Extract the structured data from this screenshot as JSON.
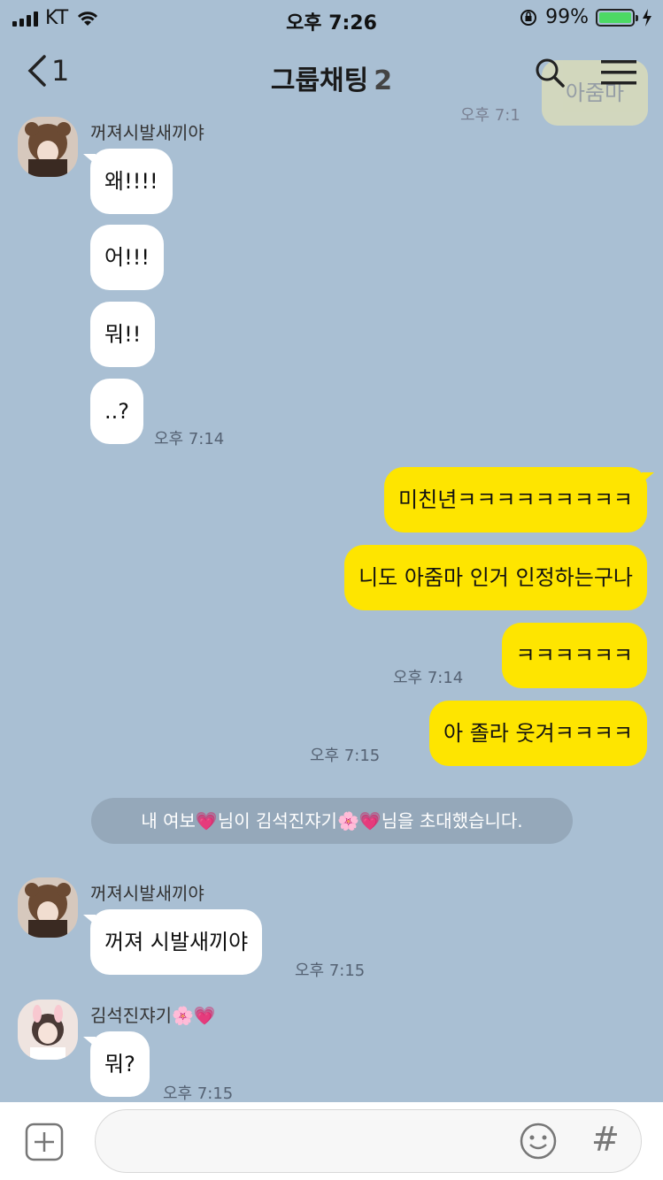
{
  "status_bar": {
    "carrier": "KT",
    "time": "오후 7:26",
    "battery": "99%"
  },
  "header": {
    "back_count": "1",
    "title": "그룹채팅",
    "member_count": "2"
  },
  "ghost": {
    "bubble": "아줌마",
    "ts": "오후 7:1"
  },
  "messages": {
    "sender1": "꺼져시발새끼야",
    "m1": "왜!!!!",
    "m2": "어!!!",
    "m3": "뭐!!",
    "m4": "..?",
    "ts1": "오후 7:14",
    "me1": "미친년ㅋㅋㅋㅋㅋㅋㅋㅋㅋ",
    "me2": "니도 아줌마 인거 인정하는구나",
    "me3": "ㅋㅋㅋㅋㅋㅋ",
    "ts2": "오후 7:14",
    "me4": "아 졸라 웃겨ㅋㅋㅋㅋ",
    "ts3": "오후 7:15",
    "notice": "내 여보💗님이 김석진쟈기🌸💗님을 초대했습니다.",
    "sender2": "꺼져시발새끼야",
    "m5": "꺼져 시발새끼야",
    "ts4": "오후 7:15",
    "sender3": "김석진쟈기🌸💗",
    "m6": "뭐?",
    "ts5": "오후 7:15"
  },
  "input": {
    "placeholder": ""
  },
  "colors": {
    "background": "#a9bfd3",
    "my_bubble": "#fee500",
    "other_bubble": "#ffffff"
  }
}
